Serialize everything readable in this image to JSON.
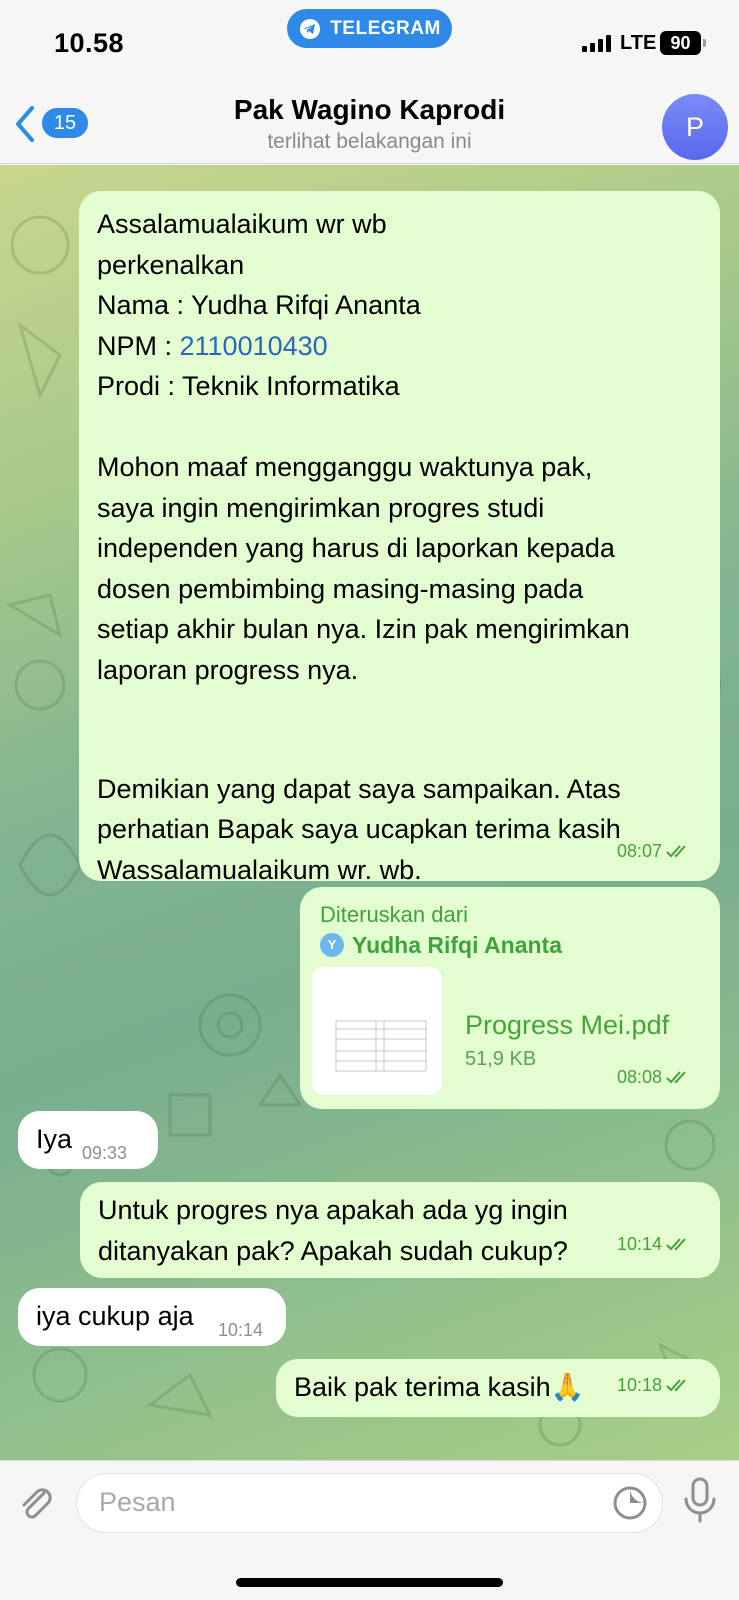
{
  "status_bar": {
    "time": "10.58",
    "app_pill": "TELEGRAM",
    "network": "LTE",
    "battery": "90"
  },
  "header": {
    "back_count": "15",
    "title": "Pak Wagino Kaprodi",
    "subtitle": "terlihat belakangan ini",
    "avatar_letter": "P"
  },
  "messages": [
    {
      "direction": "out",
      "lines": [
        "Assalamualaikum wr wb",
        "perkenalkan",
        "Nama : Yudha Rifqi Ananta",
        "NPM : ",
        "Prodi : Teknik Informatika",
        "",
        "Mohon maaf mengganggu waktunya pak,",
        "saya ingin mengirimkan progres studi",
        "independen yang harus di laporkan kepada",
        "dosen pembimbing masing-masing pada",
        "setiap akhir bulan nya. Izin pak mengirimkan",
        "laporan progress nya.",
        "",
        "",
        "Demikian yang dapat saya sampaikan. Atas",
        "perhatian Bapak saya ucapkan terima kasih",
        "Wassalamualaikum wr. wb."
      ],
      "npm_link": "2110010430",
      "time": "08:07"
    },
    {
      "direction": "out",
      "forwarded_label": "Diteruskan dari",
      "forwarded_from": "Yudha Rifqi Ananta",
      "forwarded_initial": "Y",
      "file_name": "Progress Mei.pdf",
      "file_size": "51,9 KB",
      "time": "08:08"
    },
    {
      "direction": "in",
      "text": "Iya",
      "time": "09:33"
    },
    {
      "direction": "out",
      "lines": [
        "Untuk progres nya apakah ada yg ingin",
        "ditanyakan pak? Apakah sudah cukup?"
      ],
      "time": "10:14"
    },
    {
      "direction": "in",
      "text": "iya cukup aja",
      "time": "10:14"
    },
    {
      "direction": "out",
      "text": "Baik pak terima kasih🙏",
      "time": "10:18"
    }
  ],
  "composer": {
    "placeholder": "Pesan"
  },
  "colors": {
    "accent": "#2f89e6",
    "outgoing_bubble": "#e3fdd1",
    "incoming_bubble": "#ffffff",
    "outgoing_meta": "#47a13a"
  },
  "icons": [
    "telegram-plane-icon",
    "signal-icon",
    "battery-icon",
    "back-chevron-icon",
    "double-check-icon",
    "paperclip-icon",
    "sticker-icon",
    "microphone-icon"
  ]
}
